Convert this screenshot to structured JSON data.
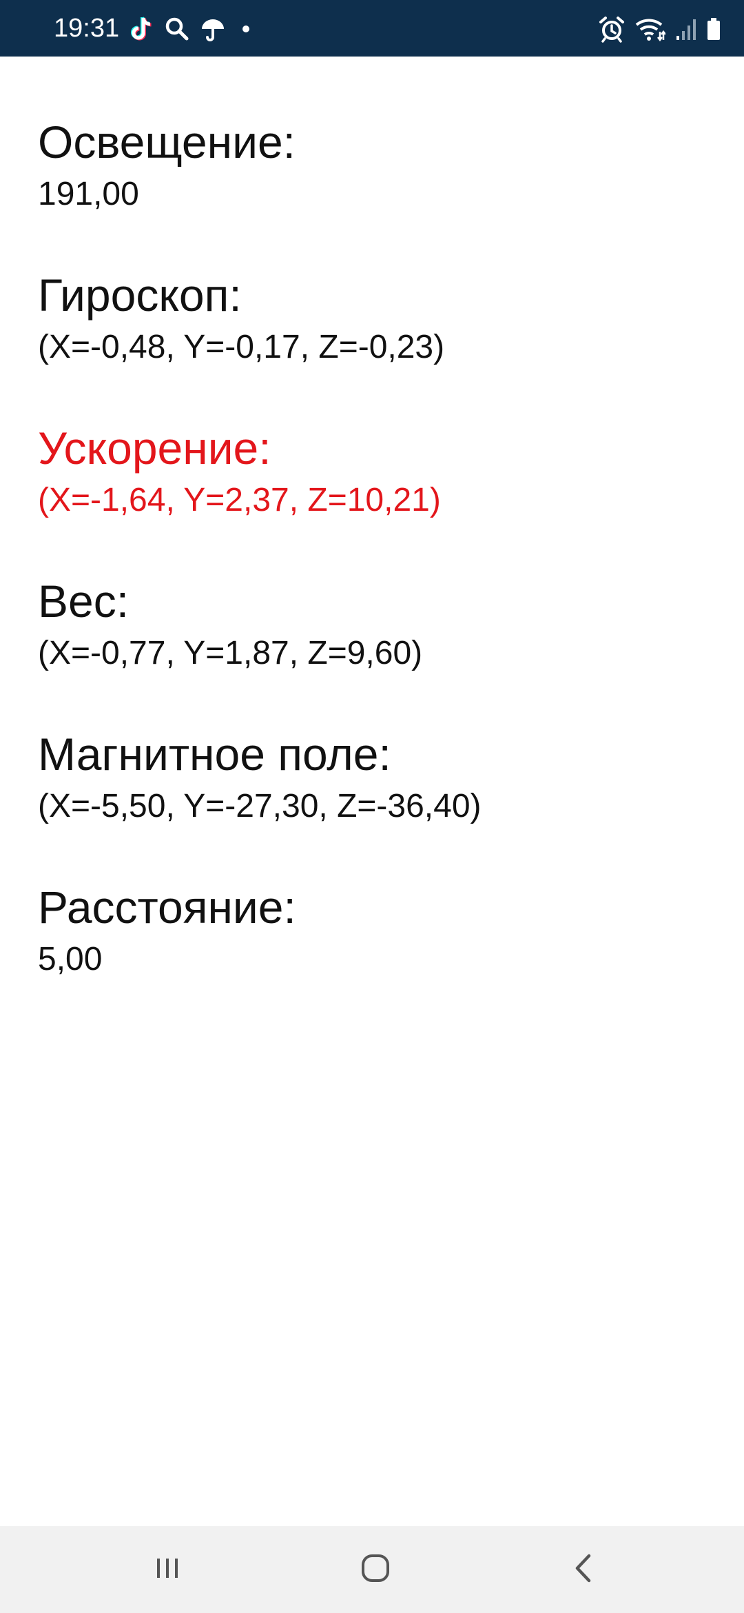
{
  "status_bar": {
    "time": "19:31",
    "left_icons": [
      "tiktok-icon",
      "search-icon",
      "umbrella-icon",
      "notification-dot-icon"
    ],
    "right_icons": [
      "alarm-icon",
      "wifi-icon",
      "signal-icon",
      "battery-icon"
    ],
    "background_color": "#0e2f4d"
  },
  "sensors": [
    {
      "label": "Освещение:",
      "value": "191,00",
      "highlighted": false
    },
    {
      "label": "Гироскоп:",
      "value": "(X=-0,48, Y=-0,17, Z=-0,23)",
      "highlighted": false
    },
    {
      "label": "Ускорение:",
      "value": "(X=-1,64, Y=2,37, Z=10,21)",
      "highlighted": true
    },
    {
      "label": "Вес:",
      "value": "(X=-0,77, Y=1,87, Z=9,60)",
      "highlighted": false
    },
    {
      "label": "Магнитное поле:",
      "value": "(X=-5,50, Y=-27,30, Z=-36,40)",
      "highlighted": false
    },
    {
      "label": "Расстояние:",
      "value": "5,00",
      "highlighted": false
    }
  ],
  "colors": {
    "text": "#111111",
    "highlight": "#e3161b",
    "nav_bar": "#f1f1f1"
  },
  "nav_bar": {
    "buttons": [
      "recents-icon",
      "home-icon",
      "back-icon"
    ]
  }
}
